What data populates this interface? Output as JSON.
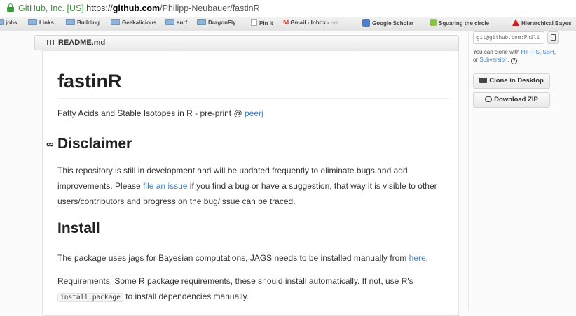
{
  "browser": {
    "site_identity": "GitHub, Inc. [US]",
    "url_scheme": "https://",
    "url_host": "github.com",
    "url_path": "/Philipp-Neubauer/fastinR"
  },
  "bookmarks": [
    {
      "label": "jobs",
      "icon": "folder-icon"
    },
    {
      "label": "Links",
      "icon": "folder-icon"
    },
    {
      "label": "Building",
      "icon": "folder-icon"
    },
    {
      "label": "Geekalicious",
      "icon": "folder-icon"
    },
    {
      "label": "surf",
      "icon": "folder-icon"
    },
    {
      "label": "DragonFly",
      "icon": "folder-icon"
    },
    {
      "label": "Pin It",
      "icon": "page-icon"
    },
    {
      "label": "Gmail - Inbox -",
      "icon": "gmail-icon"
    },
    {
      "label": "Google Scholar",
      "icon": "scholar-icon"
    },
    {
      "label": "Squaring the circle",
      "icon": "green-icon"
    },
    {
      "label": "Hierarchical Bayes",
      "icon": "red-icon"
    }
  ],
  "readme": {
    "filename": "README.md",
    "title": "fastinR",
    "tagline_text": "Fatty Acids and Stable Isotopes in R - pre-print @ ",
    "tagline_link": "peerj",
    "disclaimer_heading": "Disclaimer",
    "disclaimer_p1": "This repository is still in development and will be updated frequently to eliminate bugs and add",
    "disclaimer_p2_before": "improvements. Please ",
    "disclaimer_p2_link": "file an issue",
    "disclaimer_p2_after": " if you find a bug or have a suggestion, that way it is visible to other",
    "disclaimer_p3": "users/contributors and progress on the bug/issue can be traced.",
    "install_heading": "Install",
    "install_p1_before": "The package uses jags for Bayesian computations, JAGS needs to be installed manually from ",
    "install_p1_link": "here",
    "install_p1_after": ".",
    "install_p2": "Requirements: Some R package requirements, these should install automatically. If not, use R's",
    "install_code": "install.package",
    "install_p3_after": " to install dependencies manually."
  },
  "sidebar": {
    "clone_url": "git@github.com:Phili",
    "clone_help_before": "You can clone with ",
    "clone_help_https": "HTTPS",
    "clone_help_sep1": ", ",
    "clone_help_ssh": "SSH",
    "clone_help_sep2": ",",
    "clone_help_or": "or ",
    "clone_help_svn": "Subversion",
    "clone_help_period": ".",
    "clone_desktop_label": "Clone in Desktop",
    "download_zip_label": "Download ZIP"
  }
}
